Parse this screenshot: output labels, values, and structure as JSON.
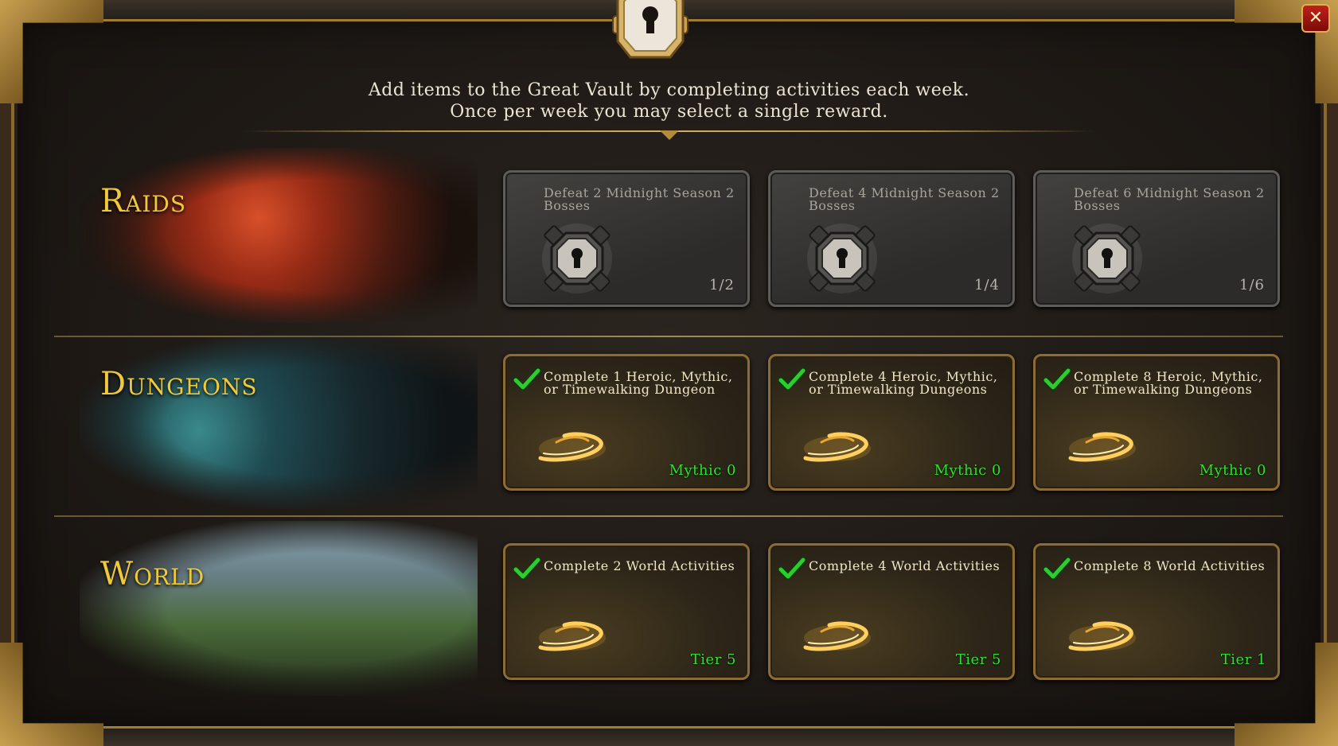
{
  "intro": {
    "line1": "Add items to the Great Vault by completing activities each week.",
    "line2": "Once per week you may select a single reward."
  },
  "close_label": "✕",
  "rows": [
    {
      "label": "Raids",
      "cards": [
        {
          "title": "Defeat 2 Midnight Season 2 Bosses",
          "progress": "1/2",
          "completed": false
        },
        {
          "title": "Defeat 4 Midnight Season 2 Bosses",
          "progress": "1/4",
          "completed": false
        },
        {
          "title": "Defeat 6 Midnight Season 2 Bosses",
          "progress": "1/6",
          "completed": false
        }
      ]
    },
    {
      "label": "Dungeons",
      "cards": [
        {
          "title": "Complete 1 Heroic, Mythic, or Timewalking Dungeon",
          "reward": "Mythic 0",
          "completed": true
        },
        {
          "title": "Complete 4 Heroic, Mythic, or Timewalking Dungeons",
          "reward": "Mythic 0",
          "completed": true
        },
        {
          "title": "Complete 8 Heroic, Mythic, or Timewalking Dungeons",
          "reward": "Mythic 0",
          "completed": true
        }
      ]
    },
    {
      "label": "World",
      "cards": [
        {
          "title": "Complete 2 World Activities",
          "reward": "Tier 5",
          "completed": true
        },
        {
          "title": "Complete 4 World Activities",
          "reward": "Tier 5",
          "completed": true
        },
        {
          "title": "Complete 8 World Activities",
          "reward": "Tier 1",
          "completed": true
        }
      ]
    }
  ],
  "icons": {
    "locked_reward": "vault-lock-icon",
    "unlocked_reward": "golden-swirl-icon",
    "complete": "checkmark-icon",
    "header": "keyhole-lock-icon",
    "close": "close-icon"
  },
  "colors": {
    "row_label": "#f0c93a",
    "reward_text": "#30e030",
    "check": "#2ecc2e",
    "frame_gold": "#a07c30"
  }
}
